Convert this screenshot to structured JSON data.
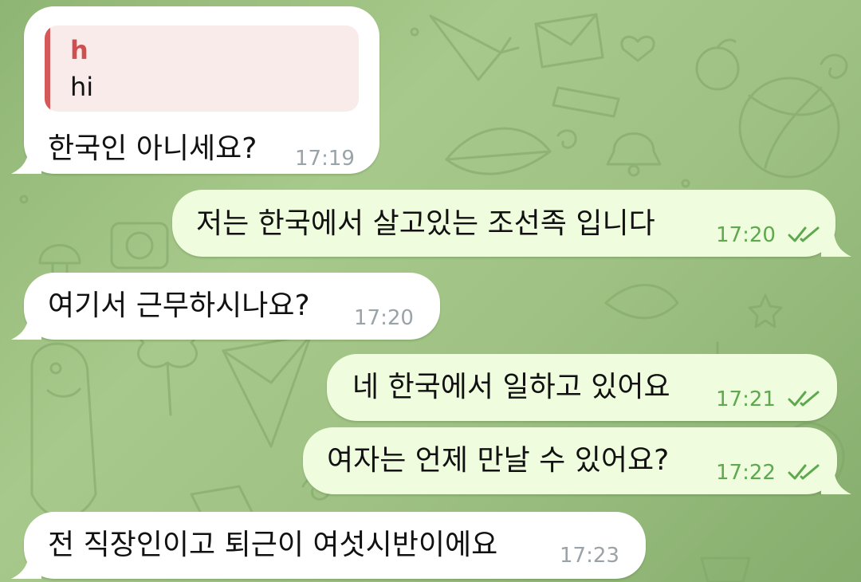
{
  "messages": [
    {
      "direction": "incoming",
      "reply": {
        "name": "h",
        "text": "hi"
      },
      "text": "한국인 아니세요?",
      "time": "17:19"
    },
    {
      "direction": "outgoing",
      "text": "저는 한국에서 살고있는 조선족 입니다",
      "time": "17:20",
      "status": "read"
    },
    {
      "direction": "incoming",
      "text": "여기서 근무하시나요?",
      "time": "17:20"
    },
    {
      "direction": "outgoing",
      "text": "네 한국에서 일하고 있어요",
      "time": "17:21",
      "status": "read"
    },
    {
      "direction": "outgoing",
      "text": "여자는 언제 만날 수 있어요?",
      "time": "17:22",
      "status": "read"
    },
    {
      "direction": "incoming",
      "text": "전 직장인이고 퇴근이 여섯시반이에요",
      "time": "17:23"
    }
  ],
  "colors": {
    "incoming_bubble": "#ffffff",
    "outgoing_bubble": "#effdde",
    "outgoing_time": "#5fa84f",
    "incoming_time": "#9aa3a8",
    "reply_accent": "#d45a59",
    "wallpaper": "#9fc284"
  },
  "icons": {
    "read_status": "double-check-icon"
  }
}
